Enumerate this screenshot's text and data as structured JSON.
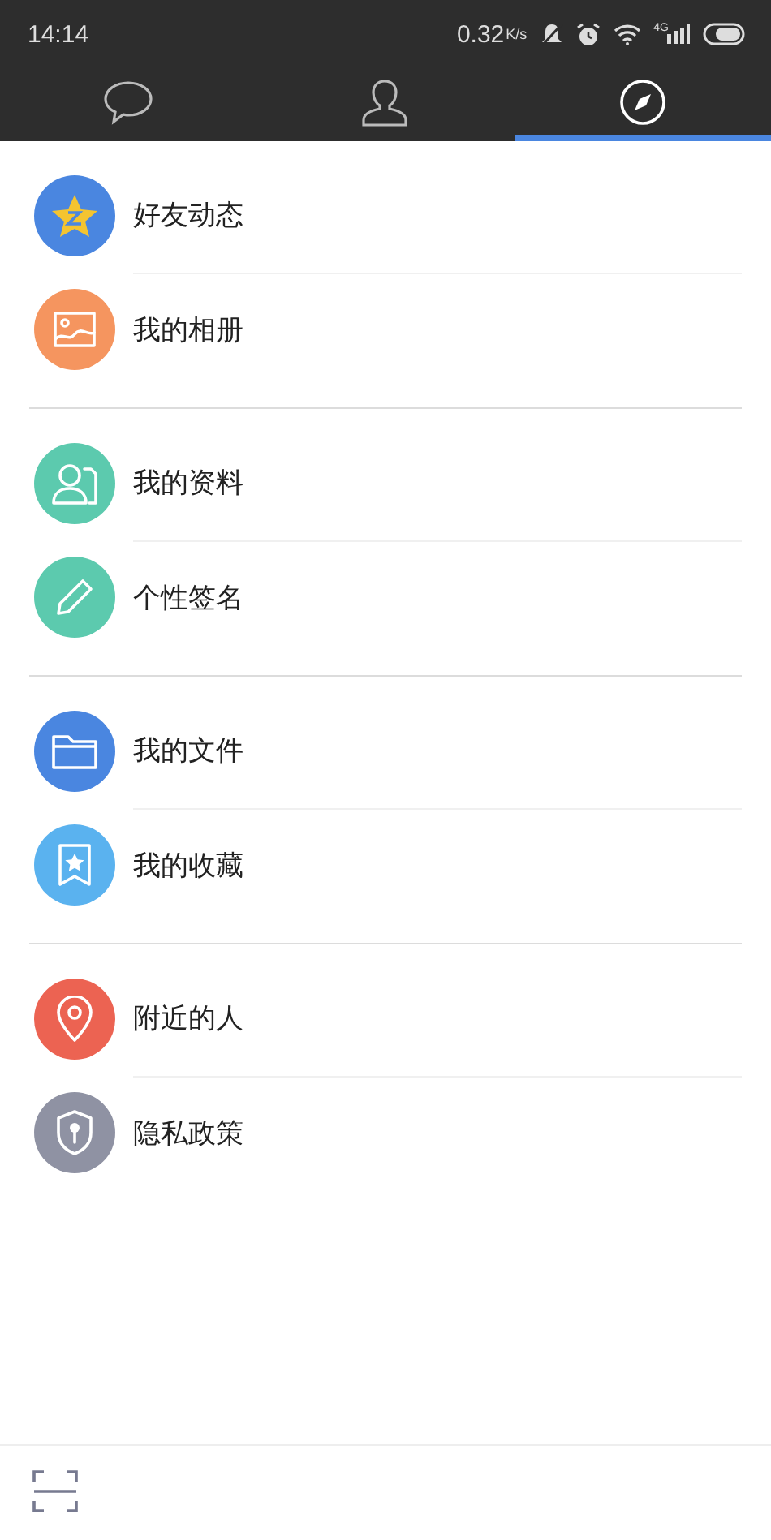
{
  "status_bar": {
    "time": "14:14",
    "speed": "0.32",
    "speed_unit": "K/s",
    "network": "4G"
  },
  "tabs": [
    {
      "kind": "messages",
      "selected": false
    },
    {
      "kind": "contacts",
      "selected": false
    },
    {
      "kind": "explore",
      "selected": true
    }
  ],
  "groups": [
    {
      "items": [
        {
          "label": "好友动态",
          "kind": "star",
          "color": "#4a86e0"
        },
        {
          "label": "我的相册",
          "kind": "photo",
          "color": "#f5955f"
        }
      ]
    },
    {
      "items": [
        {
          "label": "我的资料",
          "kind": "profile",
          "color": "#5ccaae"
        },
        {
          "label": "个性签名",
          "kind": "pencil",
          "color": "#5ccaae"
        }
      ]
    },
    {
      "items": [
        {
          "label": "我的文件",
          "kind": "folder",
          "color": "#4a86e0"
        },
        {
          "label": "我的收藏",
          "kind": "bookmark",
          "color": "#5ab2ef"
        }
      ]
    },
    {
      "items": [
        {
          "label": "附近的人",
          "kind": "pin",
          "color": "#ec6352"
        },
        {
          "label": "隐私政策",
          "kind": "shield",
          "color": "#8f92a3"
        }
      ]
    }
  ]
}
